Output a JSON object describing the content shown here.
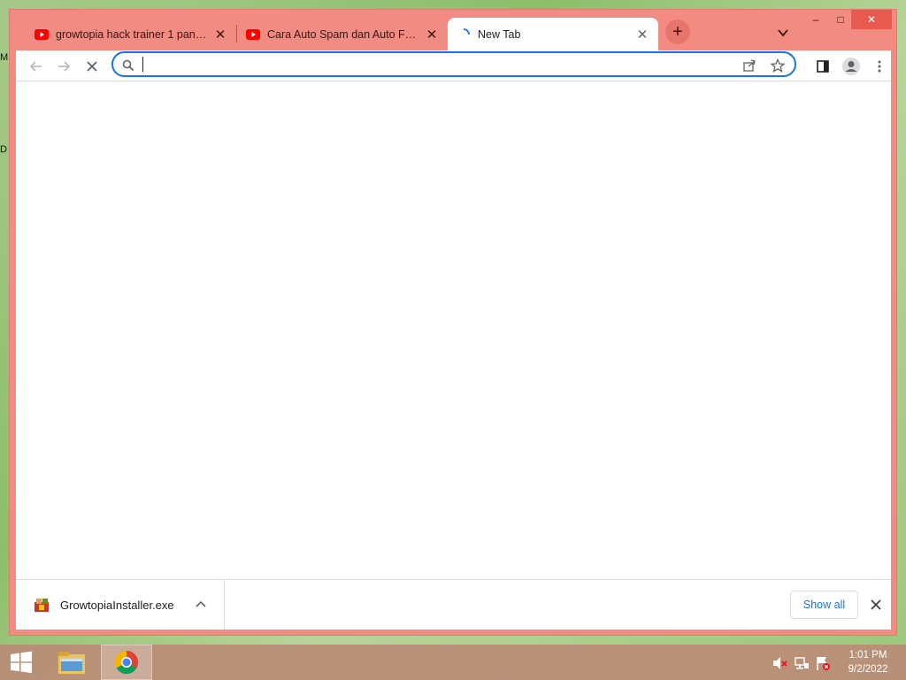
{
  "desktop": {
    "left_labels": [
      "M",
      "D"
    ]
  },
  "window": {
    "controls": {
      "minimize": "–",
      "maximize": "□",
      "close": "✕"
    }
  },
  "tabs": [
    {
      "title": "growtopia hack trainer 1 panch - ...",
      "favicon": "youtube-icon",
      "active": false
    },
    {
      "title": "Cara Auto Spam dan Auto Farm G...",
      "favicon": "youtube-icon",
      "active": false
    },
    {
      "title": "New Tab",
      "favicon": "loading-spinner-icon",
      "active": true
    }
  ],
  "toolbar": {
    "omnibox_value": "",
    "icons": [
      "back-arrow-icon",
      "forward-arrow-icon",
      "stop-icon",
      "search-icon",
      "share-icon",
      "star-icon",
      "side-panel-icon",
      "profile-icon",
      "menu-dots-icon"
    ]
  },
  "download_shelf": {
    "file_name": "GrowtopiaInstaller.exe",
    "show_all_label": "Show all"
  },
  "taskbar": {
    "apps": [
      "windows-start-icon",
      "file-explorer-icon",
      "chrome-icon"
    ],
    "tray_icons": [
      "volume-muted-icon",
      "network-icon",
      "action-center-flag-icon"
    ],
    "time": "1:01 PM",
    "date": "9/2/2022"
  },
  "colors": {
    "frame": "#f28b82",
    "accent": "#1a73e8",
    "youtube_red": "#ff0000",
    "taskbar": "#ba8c76"
  }
}
